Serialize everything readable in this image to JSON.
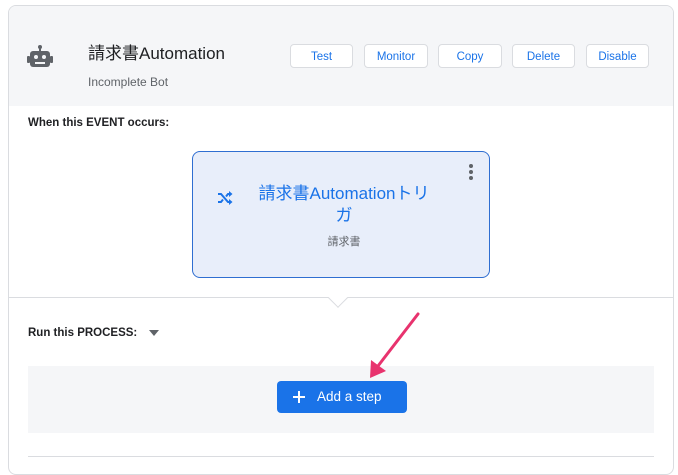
{
  "header": {
    "title": "請求書Automation",
    "subtitle": "Incomplete Bot",
    "icon": "robot-icon",
    "buttons": {
      "test": "Test",
      "monitor": "Monitor",
      "copy": "Copy",
      "delete": "Delete",
      "disable": "Disable"
    }
  },
  "event_section": {
    "label": "When this EVENT occurs:",
    "card": {
      "icon": "shuffle-icon",
      "title": "請求書Automationトリガ",
      "subtitle": "請求書",
      "menu_icon": "more-vert-icon"
    }
  },
  "process_section": {
    "label": "Run this PROCESS:",
    "add_step_label": "Add a step",
    "add_step_icon": "plus-icon"
  },
  "annotation": {
    "icon": "pointer-arrow-icon",
    "color": "#e8336e"
  },
  "colors": {
    "accent": "#1a73e8",
    "header_bg": "#f5f6f8",
    "event_card_bg": "#e8eefa"
  }
}
